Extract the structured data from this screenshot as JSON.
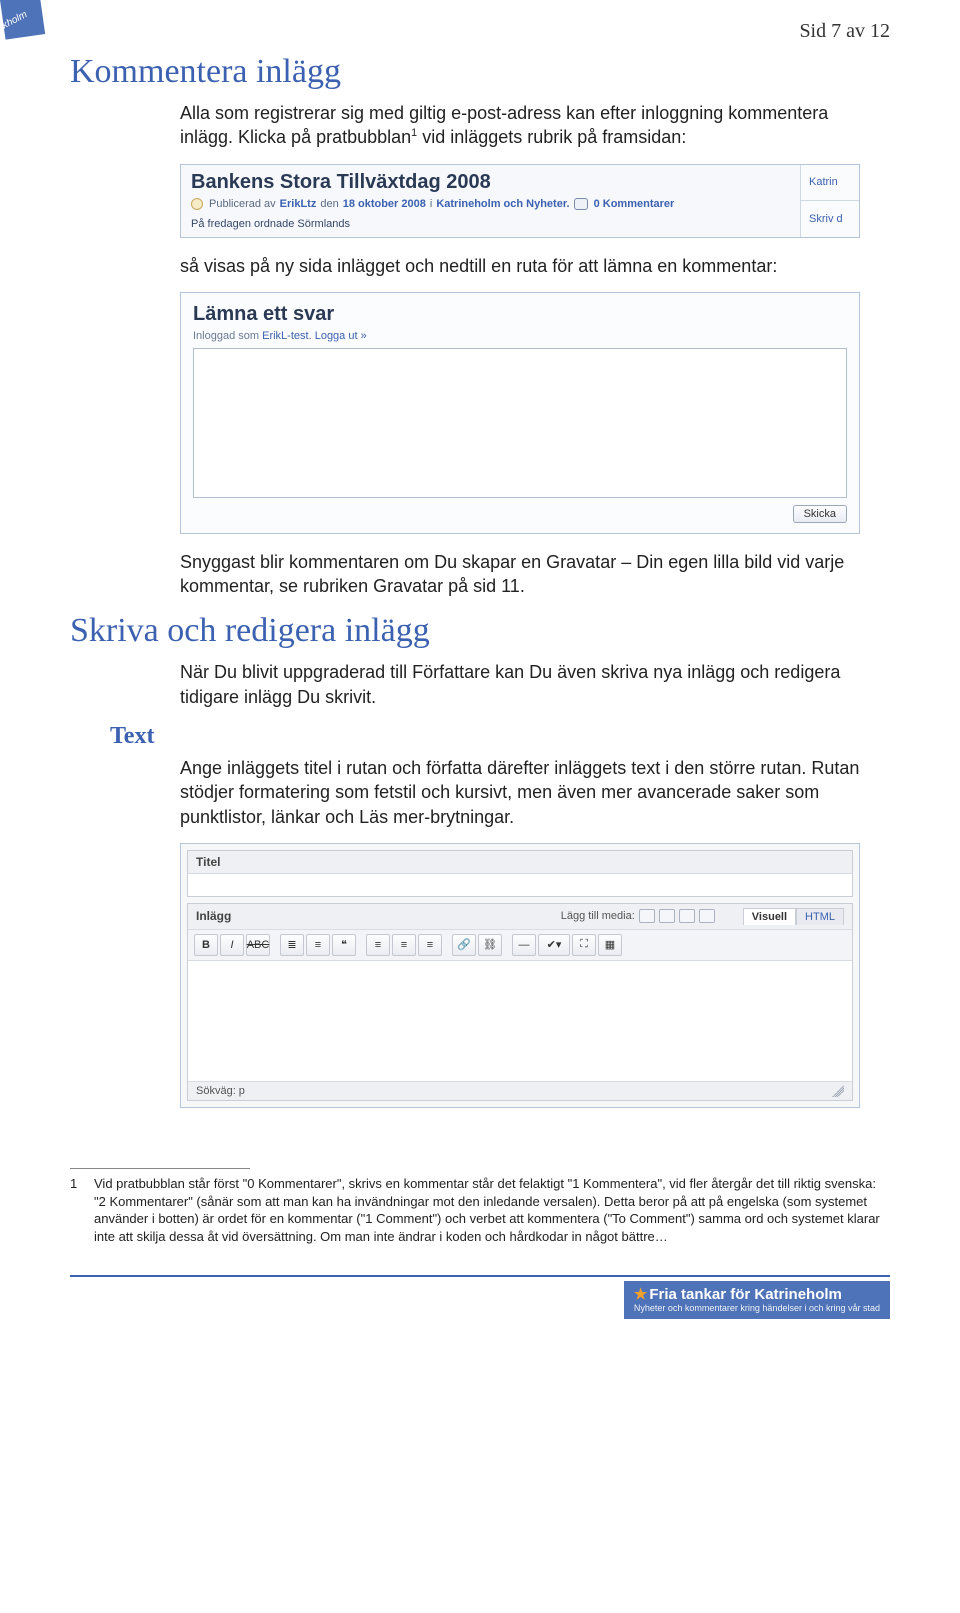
{
  "page_label": "Sid 7 av 12",
  "corner_tag": "kholm",
  "h1_a": "Kommentera inlägg",
  "p1": "Alla som registrerar sig med giltig e-post-adress kan efter inloggning kommentera inlägg. Klicka på pratbubblan",
  "p1_sup": "1",
  "p1_tail": " vid inläggets rubrik på framsidan:",
  "shot1": {
    "title": "Bankens Stora Tillväxtdag 2008",
    "pub_prefix": "Publicerad av",
    "author": "ErikLtz",
    "den": "den",
    "date": "18 oktober 2008",
    "i": "i",
    "cats": "Katrineholm och Nyheter.",
    "comments": "0 Kommentarer",
    "preview": "På fredagen ordnade Sörmlands",
    "side1": "Katrin",
    "side2": "Skriv d"
  },
  "p2": "så visas på ny sida inlägget och nedtill en ruta för att lämna en kommentar:",
  "shot2": {
    "title": "Lämna ett svar",
    "meta_a": "Inloggad som",
    "meta_user": "ErikL-test",
    "meta_b": ". ",
    "meta_logout": "Logga ut »",
    "submit": "Skicka"
  },
  "p3": "Snyggast blir kommentaren om Du skapar en Gravatar – Din egen lilla bild vid varje kommentar, se rubriken Gravatar på sid 11.",
  "h1_b": "Skriva och redigera inlägg",
  "p4": "När Du blivit uppgraderad till Författare kan Du även skriva nya inlägg och redigera tidigare inlägg Du skrivit.",
  "h2_text": "Text",
  "p5": "Ange inläggets titel i rutan och författa därefter inläggets text i den större rutan. Rutan stödjer formatering som fetstil och kursivt, men även mer avancerade saker som punktlistor, länkar och Läs mer-brytningar.",
  "shot3": {
    "titel": "Titel",
    "inlagg": "Inlägg",
    "media": "Lägg till media:",
    "tab_visual": "Visuell",
    "tab_html": "HTML",
    "status": "Sökväg: p"
  },
  "footnote_num": "1",
  "footnote_text": "Vid pratbubblan står först \"0 Kommentarer\", skrivs en kommentar står det felaktigt \"1 Kommentera\", vid fler återgår det till riktig svenska: \"2 Kommentarer\" (sånär som att man kan ha invändningar mot den inledande versalen). Detta beror på att på engelska (som systemet använder i botten) är ordet för en kommentar (\"1 Comment\") och verbet att kommentera (\"To Comment\") samma ord och systemet klarar inte att skilja dessa åt vid översättning. Om man inte ändrar i koden och hårdkodar in något bättre…",
  "footer_title": "Fria tankar för Katrineholm",
  "footer_sub": "Nyheter och kommentarer kring händelser i och kring vår stad"
}
